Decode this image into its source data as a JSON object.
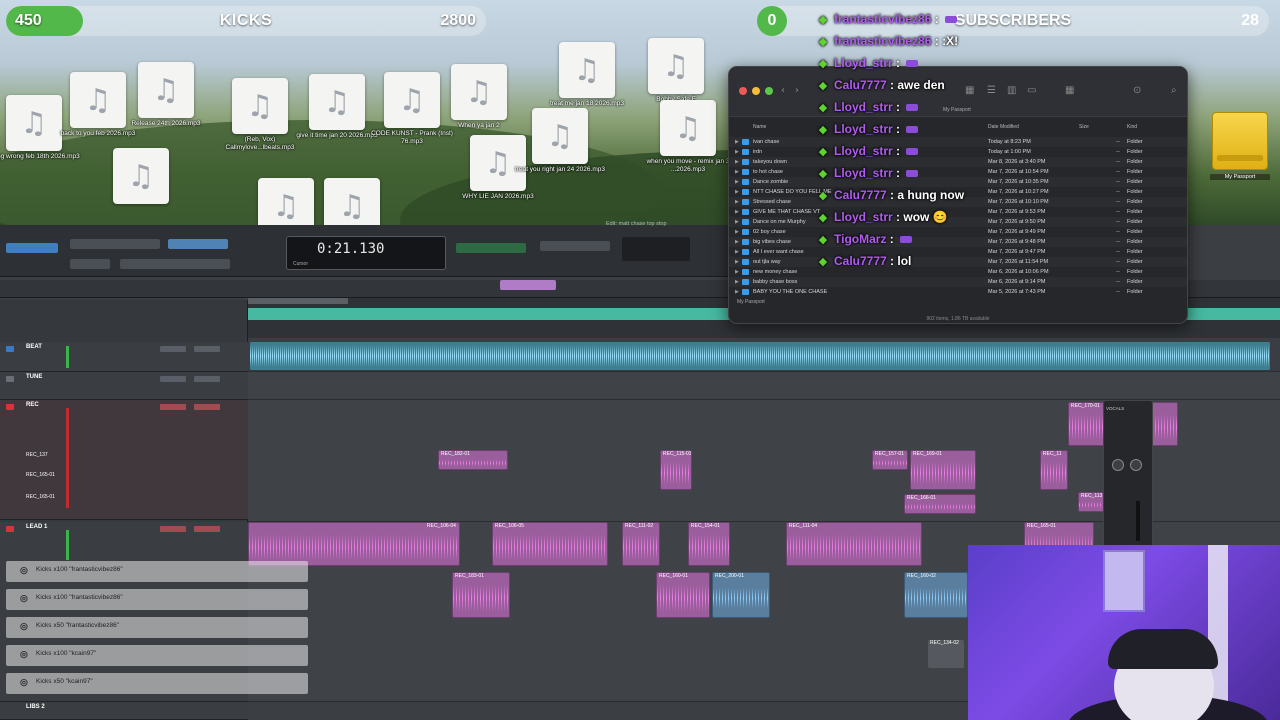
{
  "stream_overlay": {
    "kicks_bar": {
      "left_value": "450",
      "title": "KICKS",
      "right_value": "2800",
      "progress": 0.16
    },
    "subs_bar": {
      "left_value": "0",
      "title": "SUBSCRIBERS",
      "right_value": "28",
      "progress": 0.0
    }
  },
  "desktop": {
    "files": [
      {
        "label": "going wrong feb 18th 2026.mp3"
      },
      {
        "label": "back to you feb 2026.mp3"
      },
      {
        "label": ""
      },
      {
        "label": "Release 24th 2026.mp3"
      },
      {
        "label": "(Reb, Vox) Callmylove...lbeats.mp3"
      },
      {
        "label": "give it time jan 20 2026.mp3"
      },
      {
        "label": "CODE KUNST - Prank (Inst) 76.mp3"
      },
      {
        "label": "When ya jan 2"
      },
      {
        "label": ""
      },
      {
        "label": ""
      },
      {
        "label": "WHY LIE JAN 2026.mp3"
      },
      {
        "label": "treat you right jan 24 2026.mp3"
      },
      {
        "label": "treat me jan 18 2026.mp3"
      },
      {
        "label": "Bobby Safe F"
      },
      {
        "label": "when you move - remix jan 3 ...2026.mp3"
      }
    ],
    "drive_label": "My Passport"
  },
  "finder": {
    "title": "ivan chase",
    "sidebar_label": "My Passport",
    "columns": {
      "name": "Name",
      "date": "Date Modified",
      "size": "Size",
      "kind": "Kind"
    },
    "rows": [
      {
        "name": "ivan chase",
        "date": "Today at 8:23 PM",
        "size": "--",
        "kind": "Folder"
      },
      {
        "name": "irdn",
        "date": "Today at 1:00 PM",
        "size": "--",
        "kind": "Folder"
      },
      {
        "name": "takeyou down",
        "date": "Mar 8, 2026 at 3:40 PM",
        "size": "--",
        "kind": "Folder"
      },
      {
        "name": "to hot chase",
        "date": "Mar 7, 2026 at 10:54 PM",
        "size": "--",
        "kind": "Folder"
      },
      {
        "name": "Dance zombie",
        "date": "Mar 7, 2026 at 10:35 PM",
        "size": "--",
        "kind": "Folder"
      },
      {
        "name": "NTT CHASE DO YOU FELL ME",
        "date": "Mar 7, 2026 at 10:27 PM",
        "size": "--",
        "kind": "Folder"
      },
      {
        "name": "Stressed chase",
        "date": "Mar 7, 2026 at 10:10 PM",
        "size": "--",
        "kind": "Folder"
      },
      {
        "name": "GIVE ME THAT CHASE VT",
        "date": "Mar 7, 2026 at 9:53 PM",
        "size": "--",
        "kind": "Folder"
      },
      {
        "name": "Dance on me Murphy",
        "date": "Mar 7, 2026 at 9:50 PM",
        "size": "--",
        "kind": "Folder"
      },
      {
        "name": "02 boy chase",
        "date": "Mar 7, 2026 at 9:49 PM",
        "size": "--",
        "kind": "Folder"
      },
      {
        "name": "big vibes chase",
        "date": "Mar 7, 2026 at 9:48 PM",
        "size": "--",
        "kind": "Folder"
      },
      {
        "name": "All I ever want chase",
        "date": "Mar 7, 2026 at 9:47 PM",
        "size": "--",
        "kind": "Folder"
      },
      {
        "name": "out tjla way",
        "date": "Mar 7, 2026 at 11:54 PM",
        "size": "--",
        "kind": "Folder"
      },
      {
        "name": "new money chase",
        "date": "Mar 6, 2026 at 10:06 PM",
        "size": "--",
        "kind": "Folder"
      },
      {
        "name": "babby chase boss",
        "date": "Mar 6, 2026 at 9:14 PM",
        "size": "--",
        "kind": "Folder"
      },
      {
        "name": "BABY YOU THE ONE CHASE",
        "date": "Mar 5, 2026 at 7:43 PM",
        "size": "--",
        "kind": "Folder"
      }
    ],
    "footer_path": "My Passport",
    "status": "902 items, 1.86 TB available"
  },
  "chat": [
    {
      "user": "frantasticvibez86",
      "message": ""
    },
    {
      "user": "frantasticvibez86",
      "message": ":X!"
    },
    {
      "user": "Lloyd_strr",
      "message": ""
    },
    {
      "user": "Calu7777",
      "message": "awe den"
    },
    {
      "user": "Lloyd_strr",
      "message": ""
    },
    {
      "user": "Lloyd_strr",
      "message": ""
    },
    {
      "user": "Lloyd_strr",
      "message": ""
    },
    {
      "user": "Lloyd_strr",
      "message": ""
    },
    {
      "user": "Calu7777",
      "message": "a hung now"
    },
    {
      "user": "Lloyd_strr",
      "message": "wow 😊"
    },
    {
      "user": "TigoMarz",
      "message": ""
    },
    {
      "user": "Calu7777",
      "message": "lol"
    }
  ],
  "daw": {
    "edit_window_title": "Edit: matt chase top stop",
    "counter_time": "0:21.130",
    "counter_sub": "Cursor",
    "tracks": [
      {
        "name": "BEAT"
      },
      {
        "name": "TUNE"
      },
      {
        "name": "REC"
      },
      {
        "name": "REC_137"
      },
      {
        "name": "REC_165-01"
      },
      {
        "name": "REC_165-01"
      },
      {
        "name": "LEAD 1"
      },
      {
        "name": "LIBS 2"
      }
    ],
    "clips": [
      {
        "name": "REC_182-01"
      },
      {
        "name": "REC_115-03"
      },
      {
        "name": "REC_157-01"
      },
      {
        "name": "REC_169-01"
      },
      {
        "name": "REC_11"
      },
      {
        "name": "REC_170-01"
      },
      {
        "name": "REC_166-01"
      },
      {
        "name": "REC_113"
      },
      {
        "name": "REC_106-04"
      },
      {
        "name": "REC_106-05"
      },
      {
        "name": "REC_111-02"
      },
      {
        "name": "REC_154-01"
      },
      {
        "name": "REC_111-04"
      },
      {
        "name": "REC_165-01"
      },
      {
        "name": "REC_183-01"
      },
      {
        "name": "REC_160-01"
      },
      {
        "name": "REC_200-01"
      },
      {
        "name": "REC_160-02"
      },
      {
        "name": "REC_134-02"
      }
    ],
    "plugin_title": "VOCALS"
  },
  "alerts": [
    {
      "text": "Kicks x100 \"frantasticvibez86\""
    },
    {
      "text": "Kicks x100 \"frantasticvibez86\""
    },
    {
      "text": "Kicks x50 \"frantasticvibez86\""
    },
    {
      "text": "Kicks x100 \"kcain97\""
    },
    {
      "text": "Kicks x50 \"kcain97\""
    }
  ],
  "colors": {
    "accent_green": "#53b84a",
    "chat_user": "#b05cf0",
    "clip_pink": "#9b5e9d",
    "clip_blue": "#5a7e9e",
    "beat_track": "#46b9a0"
  }
}
